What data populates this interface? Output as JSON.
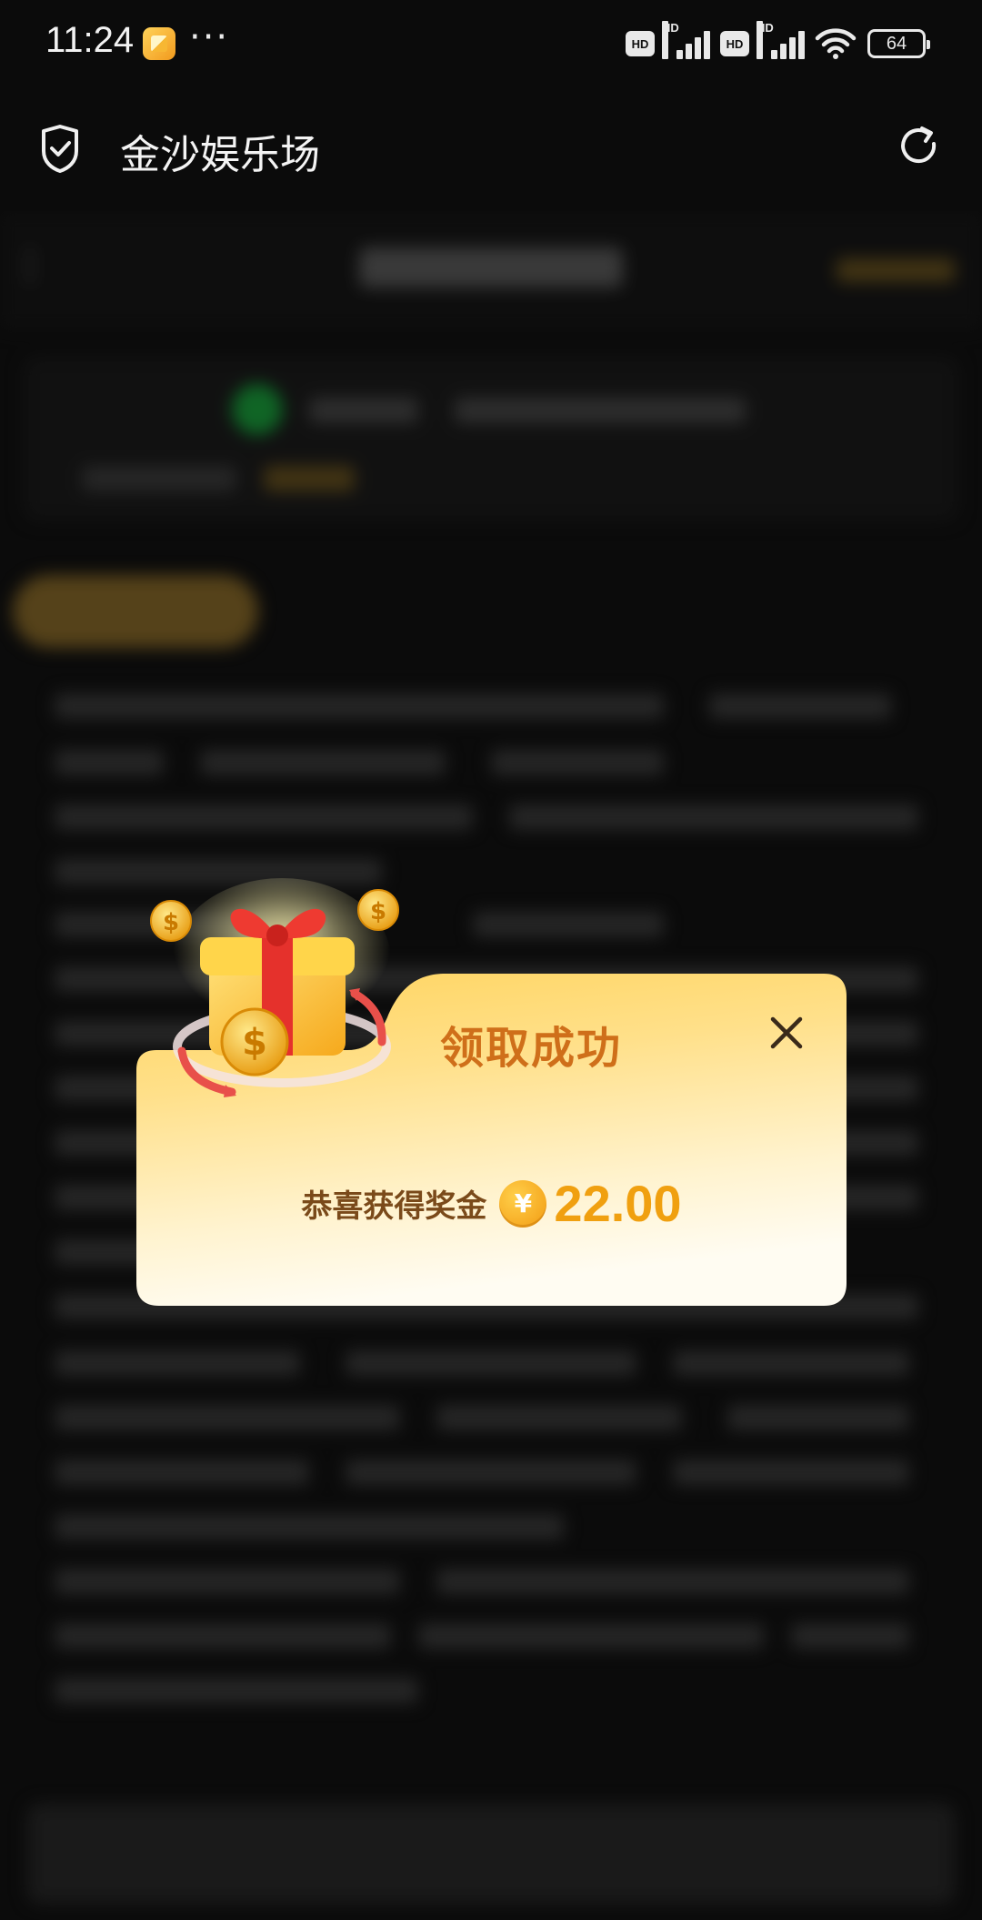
{
  "status_bar": {
    "time": "11:24",
    "more": "···",
    "battery": "64",
    "hd": "HD"
  },
  "header": {
    "title": "金沙娱乐场"
  },
  "dialog": {
    "title": "领取成功",
    "reward_label": "恭喜获得奖金",
    "currency_symbol": "¥",
    "amount": "22.00"
  },
  "colors": {
    "dialog_top": "#ffd86b",
    "dialog_bottom": "#fffaf0",
    "title": "#cf6f1a",
    "amount": "#f0a010"
  }
}
